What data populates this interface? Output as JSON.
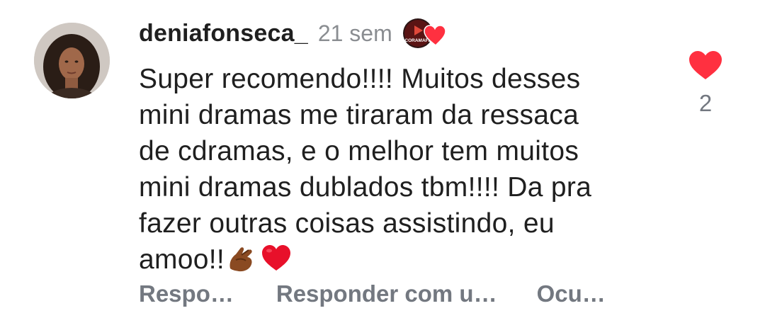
{
  "comment": {
    "username": "deniafonseca_",
    "time": "21 sem",
    "author_badge_text": "CORAMAFL",
    "text": "Super recomendo!!!! Muitos desses\nmini dramas me tiraram da ressaca\nde cdramas, e o melhor tem muitos\nmini dramas dublados tbm!!!! Da pra\nfazer outras coisas assistindo, eu\namoo!!",
    "trailing_emojis": [
      "pinching-hand-emoji",
      "red-heart-emoji"
    ],
    "like_count": "2"
  },
  "actions": {
    "reply": "Respo…",
    "reply_with": "Responder com u…",
    "hide": "Ocu…"
  },
  "colors": {
    "heart": "#ff3040",
    "text": "#1f1f1f",
    "muted": "#737880"
  }
}
